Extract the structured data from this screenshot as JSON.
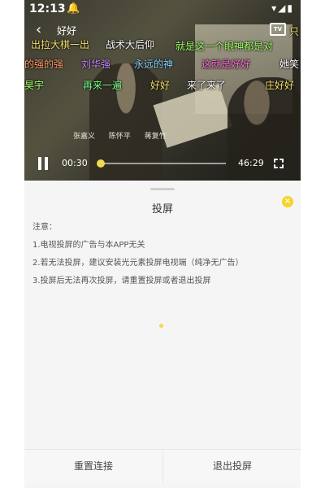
{
  "status_bar": {
    "time": "12:13",
    "notification_icon": "bell-icon",
    "right_icons": "▾◢▮"
  },
  "player": {
    "back_icon": "back-arrow-icon",
    "back_glyph": "‹",
    "title": "好好",
    "cast_icon": "tv-cast-icon",
    "cast_label": "TV",
    "credits": "张嘉义 陈怀平 蒋复竹",
    "current_time": "00:30",
    "total_time": "46:29",
    "progress": 0.011,
    "pause_icon": "pause-icon",
    "fullscreen_icon": "fullscreen-icon",
    "accent_color": "#f2d94e"
  },
  "danmaku": [
    {
      "text": "出拉大棋一出",
      "color": "#f5e06a"
    },
    {
      "text": "战术大后仰",
      "color": "#ffffff"
    },
    {
      "text": "只",
      "color": "#f5e06a"
    },
    {
      "text": "就是这一个眼神都是对",
      "color": "#a6ff6a"
    },
    {
      "text": "的强的强",
      "color": "#ff9e6a"
    },
    {
      "text": "刘华强",
      "color": "#c98bff"
    },
    {
      "text": "永远的神",
      "color": "#8ad4ff"
    },
    {
      "text": "这就是好好",
      "color": "#ff6ad8"
    },
    {
      "text": "她笑",
      "color": "#ffffff"
    },
    {
      "text": "昊宇",
      "color": "#a6ff6a"
    },
    {
      "text": "再来一遍",
      "color": "#7dff8a"
    },
    {
      "text": "好好",
      "color": "#f5e06a"
    },
    {
      "text": "来了来了",
      "color": "#ffffff"
    },
    {
      "text": "庄好好",
      "color": "#f5e06a"
    }
  ],
  "sheet": {
    "title": "投屏",
    "close_icon": "close-icon",
    "close_glyph": "×",
    "notice_heading": "注意：",
    "notice_items": [
      "1.电视投屏的广告与本APP无关",
      "2.若无法投屏，建议安装光元素投屏电视端（纯净无广告）",
      "3.投屏后无法再次投屏，请重置投屏或者退出投屏"
    ],
    "reconnect_label": "重置连接",
    "exit_label": "退出投屏"
  }
}
